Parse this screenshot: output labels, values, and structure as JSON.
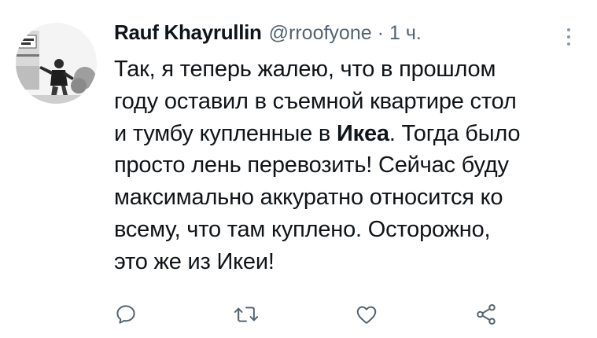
{
  "tweet": {
    "display_name": "Rauf Khayrullin",
    "handle": "@rroofyone",
    "separator": "·",
    "time": "1 ч.",
    "text": {
      "line1": "Так, я теперь жалею, что в прошлом",
      "line2": "году оставил в съемной квартире стол",
      "line3_before": "и тумбу купленные в ",
      "line3_bold": "Икеа",
      "line3_after": ". Тогда было",
      "line4": "просто лень перевозить! Сейчас буду",
      "line5": "максимально аккуратно относится ко",
      "line6": "всему, что там куплено. Осторожно,",
      "line7": "это же из Икеи!"
    },
    "actions": {
      "reply_icon": "reply-icon",
      "retweet_icon": "retweet-icon",
      "like_icon": "like-icon",
      "share_icon": "share-icon"
    }
  },
  "colors": {
    "text_primary": "#0f1419",
    "text_secondary": "#536471",
    "icon": "#536471"
  }
}
